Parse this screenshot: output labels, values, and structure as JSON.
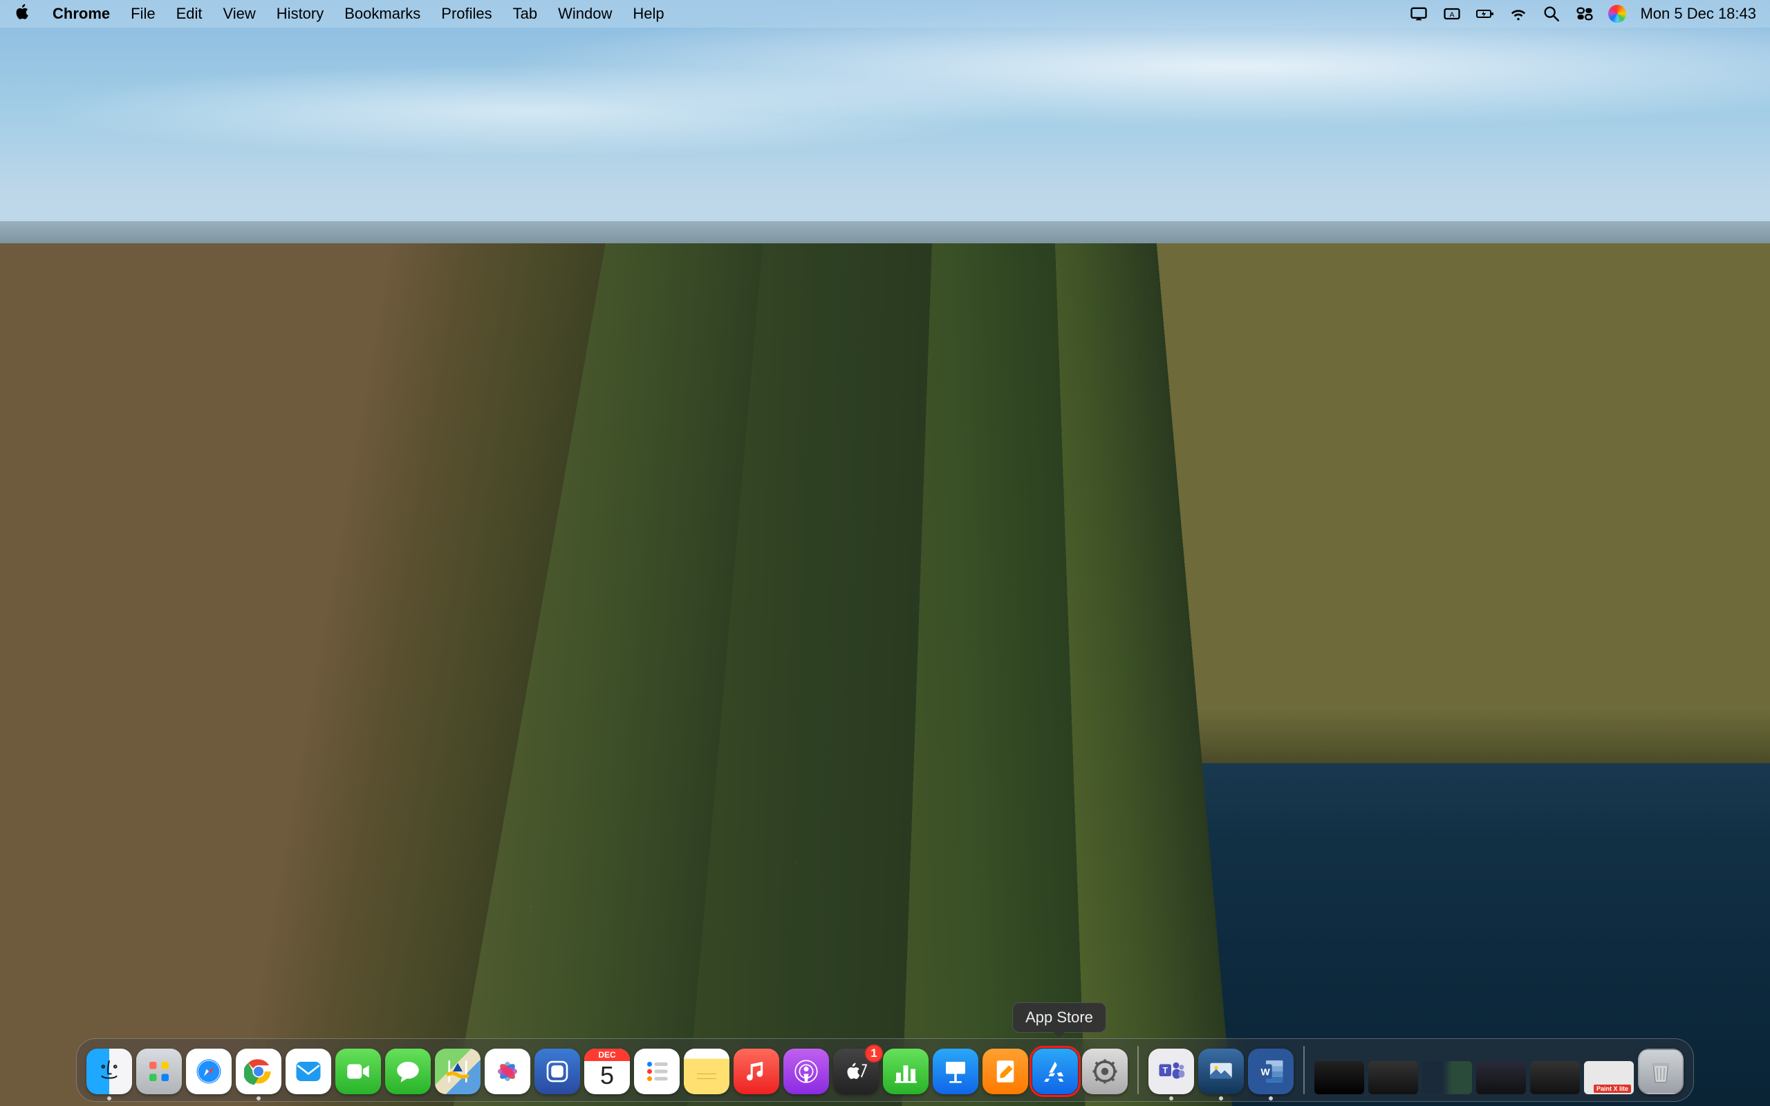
{
  "menubar": {
    "app_name": "Chrome",
    "items": [
      "File",
      "Edit",
      "View",
      "History",
      "Bookmarks",
      "Profiles",
      "Tab",
      "Window",
      "Help"
    ],
    "datetime": "Mon 5 Dec  18:43"
  },
  "calendar_icon": {
    "month_abbr": "DEC",
    "day": "5"
  },
  "tooltip": {
    "label": "App Store"
  },
  "dock": {
    "badge_tv": "1",
    "mini_label_last": "Paint X lite",
    "items": [
      {
        "name": "finder",
        "label": "Finder"
      },
      {
        "name": "launchpad",
        "label": "Launchpad"
      },
      {
        "name": "safari",
        "label": "Safari"
      },
      {
        "name": "chrome",
        "label": "Google Chrome"
      },
      {
        "name": "mail",
        "label": "Mail"
      },
      {
        "name": "facetime",
        "label": "FaceTime"
      },
      {
        "name": "messages",
        "label": "Messages"
      },
      {
        "name": "maps",
        "label": "Maps"
      },
      {
        "name": "photos",
        "label": "Photos"
      },
      {
        "name": "clips",
        "label": "Clips"
      },
      {
        "name": "calendar",
        "label": "Calendar"
      },
      {
        "name": "reminders",
        "label": "Reminders"
      },
      {
        "name": "notes",
        "label": "Notes"
      },
      {
        "name": "music",
        "label": "Music"
      },
      {
        "name": "podcasts",
        "label": "Podcasts"
      },
      {
        "name": "tv",
        "label": "TV"
      },
      {
        "name": "numbers",
        "label": "Numbers"
      },
      {
        "name": "keynote",
        "label": "Keynote"
      },
      {
        "name": "pages",
        "label": "Pages"
      },
      {
        "name": "appstore",
        "label": "App Store"
      },
      {
        "name": "settings",
        "label": "System Settings"
      },
      {
        "name": "teams",
        "label": "Microsoft Teams"
      },
      {
        "name": "preview",
        "label": "Preview"
      },
      {
        "name": "word",
        "label": "Microsoft Word"
      },
      {
        "name": "trash",
        "label": "Trash"
      }
    ]
  }
}
